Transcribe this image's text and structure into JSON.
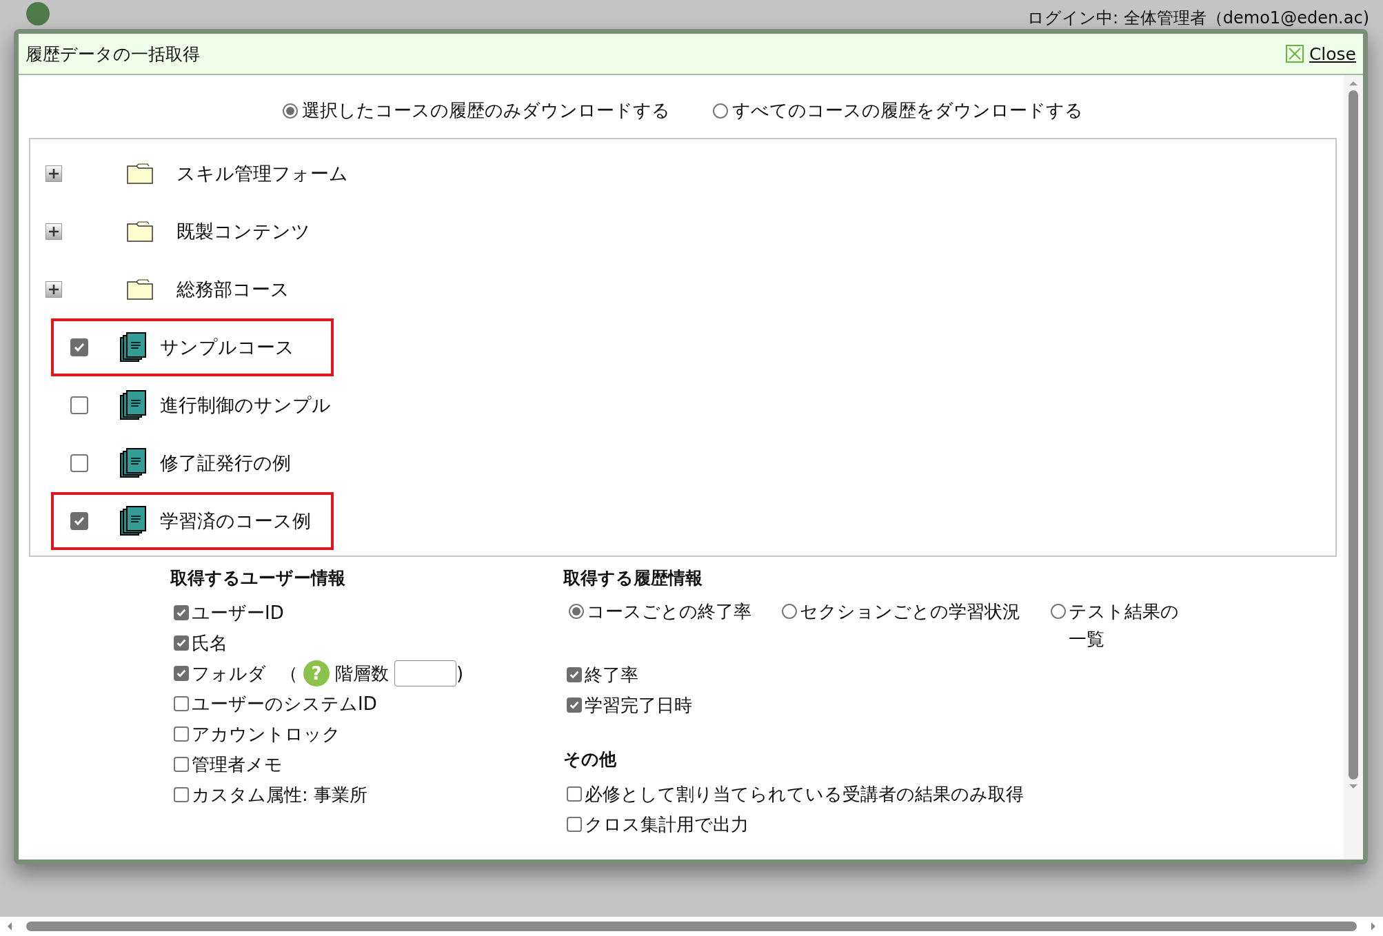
{
  "header": {
    "login": "ログイン中: 全体管理者（demo1@eden.ac)"
  },
  "dialog": {
    "title": "履歴データの一括取得",
    "close": "Close"
  },
  "scope_options": [
    {
      "label": "選択したコースの履歴のみダウンロードする",
      "selected": true
    },
    {
      "label": "すべてのコースの履歴をダウンロードする",
      "selected": false
    }
  ],
  "tree": [
    {
      "kind": "folder",
      "label": "スキル管理フォーム",
      "expanded": false
    },
    {
      "kind": "folder",
      "label": "既製コンテンツ",
      "expanded": false
    },
    {
      "kind": "folder",
      "label": "総務部コース",
      "expanded": false
    },
    {
      "kind": "course",
      "label": "サンプルコース",
      "checked": true,
      "highlighted": true
    },
    {
      "kind": "course",
      "label": "進行制御のサンプル",
      "checked": false,
      "highlighted": false
    },
    {
      "kind": "course",
      "label": "修了証発行の例",
      "checked": false,
      "highlighted": false
    },
    {
      "kind": "course",
      "label": "学習済のコース例",
      "checked": true,
      "highlighted": true
    }
  ],
  "user_info": {
    "heading": "取得するユーザー情報",
    "options": [
      {
        "kind": "plain",
        "label": "ユーザーID",
        "checked": true
      },
      {
        "kind": "plain",
        "label": "氏名",
        "checked": true
      },
      {
        "kind": "depth",
        "label": "フォルダ",
        "checked": true,
        "open": "（",
        "help": "?",
        "depth_label": "階層数",
        "close": ")"
      },
      {
        "kind": "plain",
        "label": "ユーザーのシステムID",
        "checked": false
      },
      {
        "kind": "plain",
        "label": "アカウントロック",
        "checked": false
      },
      {
        "kind": "plain",
        "label": "管理者メモ",
        "checked": false
      },
      {
        "kind": "plain",
        "label": "カスタム属性: 事業所",
        "checked": false
      }
    ]
  },
  "history_info": {
    "heading": "取得する履歴情報",
    "modes": [
      {
        "label": "コースごとの終了率",
        "selected": true
      },
      {
        "label": "セクションごとの学習状況",
        "selected": false
      },
      {
        "label": "テスト結果の一覧",
        "selected": false
      }
    ],
    "options": [
      {
        "label": "終了率",
        "checked": true
      },
      {
        "label": "学習完了日時",
        "checked": true
      }
    ]
  },
  "other": {
    "heading": "その他",
    "options": [
      {
        "label": "必修として割り当てられている受講者の結果のみ取得",
        "checked": false
      },
      {
        "label": "クロス集計用で出力",
        "checked": false
      }
    ]
  }
}
